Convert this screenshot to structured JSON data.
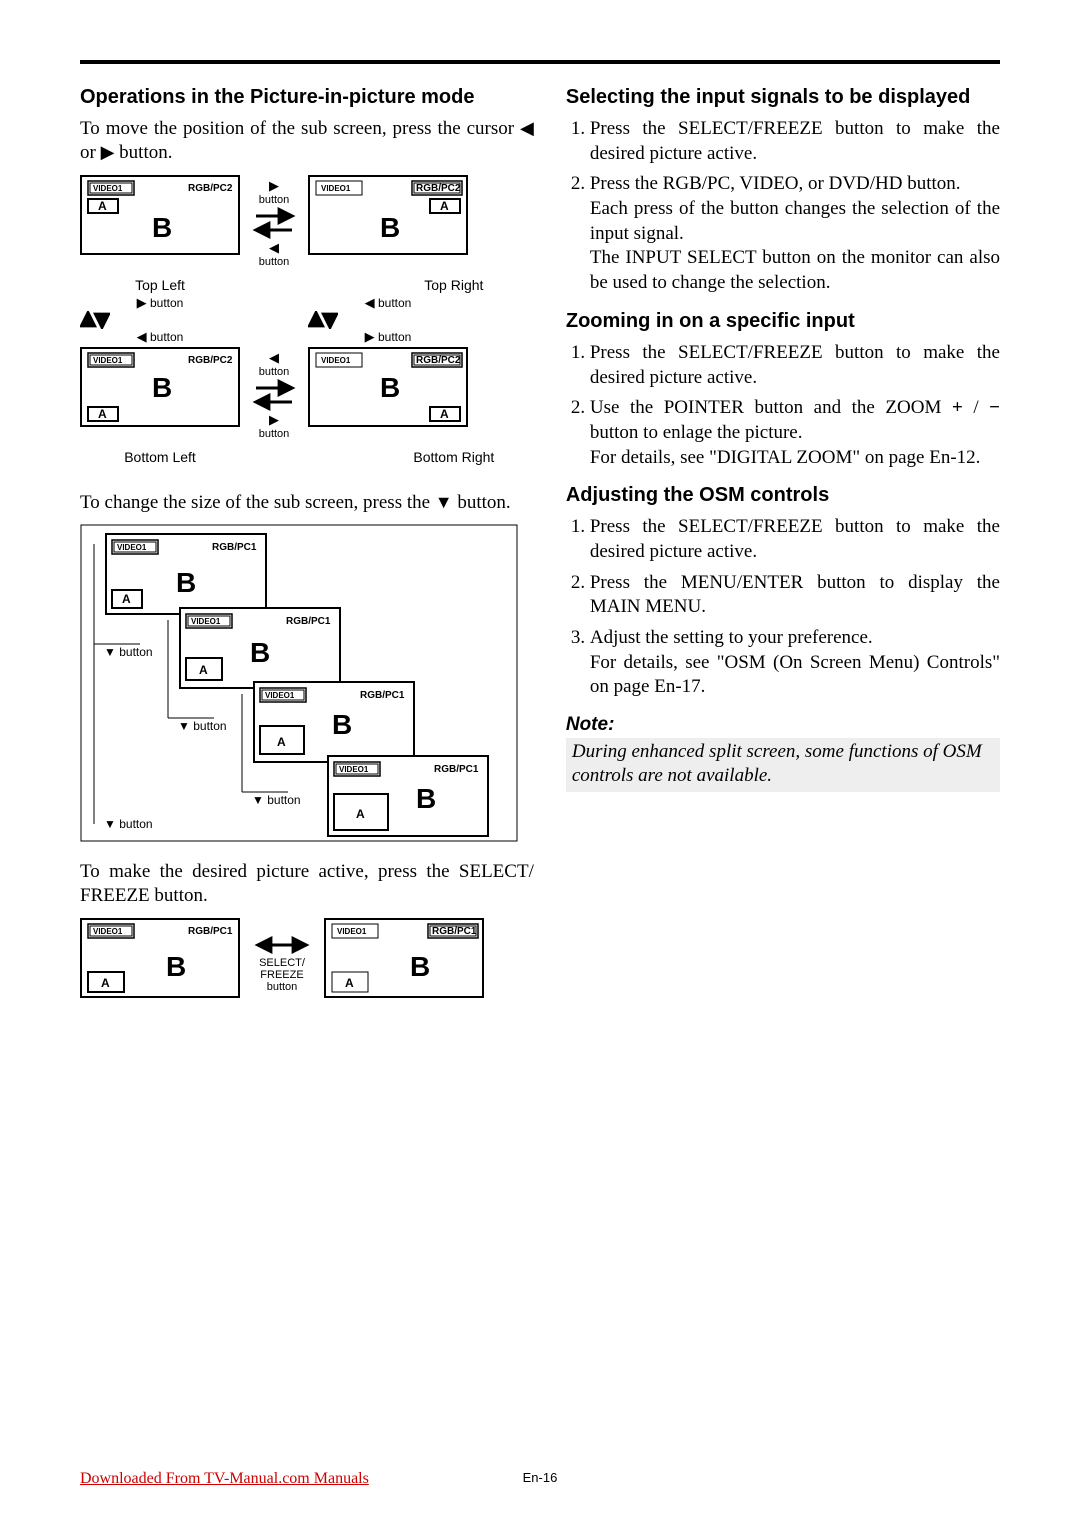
{
  "left": {
    "h1": "Operations in the Picture-in-picture mode",
    "p1a": "To move the position of the sub screen, press the cursor ",
    "p1b": " or ",
    "p1c": " button.",
    "cap_tl": "Top Left",
    "cap_tr": "Top Right",
    "cap_bl": "Bottom Left",
    "cap_br": "Bottom Right",
    "btn": "button",
    "p2a": "To change the size of the sub screen, press the ",
    "p2b": " button.",
    "p3": "To make the desired picture active, press the SELECT/ FREEZE button.",
    "sf1": "SELECT/",
    "sf2": "FREEZE",
    "sf3": "button",
    "v1": "VIDEO1",
    "rp2": "RGB/PC2",
    "rp1": "RGB/PC1",
    "A": "A",
    "B": "B"
  },
  "right": {
    "h1": "Selecting the input signals to be displayed",
    "s1_1": "Press the SELECT/FREEZE button to make the desired picture active.",
    "s1_2a": "Press the RGB/PC, VIDEO, or DVD/HD button.",
    "s1_2b": "Each press of the button changes the selection of the input signal.",
    "s1_2c": "The INPUT SELECT button on the monitor can also be used to change the selection.",
    "h2": "Zooming in on a specific input",
    "s2_1": "Press the SELECT/FREEZE button to make the desired picture active.",
    "s2_2a": "Use the POINTER button and the ZOOM ",
    "s2_2b": " / ",
    "s2_2c": " button to enlage the picture.",
    "s2_2d": "For details, see \"DIGITAL ZOOM\" on page En-12.",
    "h3": "Adjusting the OSM controls",
    "s3_1": "Press the SELECT/FREEZE button to make the desired picture active.",
    "s3_2": "Press the MENU/ENTER button to display the MAIN MENU.",
    "s3_3a": "Adjust the setting to your preference.",
    "s3_3b": "For details, see \"OSM (On Screen Menu) Controls\" on page En-17.",
    "note_t": "Note:",
    "note_b": "During enhanced split screen, some functions of OSM controls are not available.",
    "plus": "+",
    "minus": "−"
  },
  "footer": {
    "dl": "Downloaded From TV-Manual.com Manuals",
    "pg": "En-16"
  },
  "glyph": {
    "left": "◀",
    "right": "▶",
    "down": "▼",
    "up": "▲"
  }
}
